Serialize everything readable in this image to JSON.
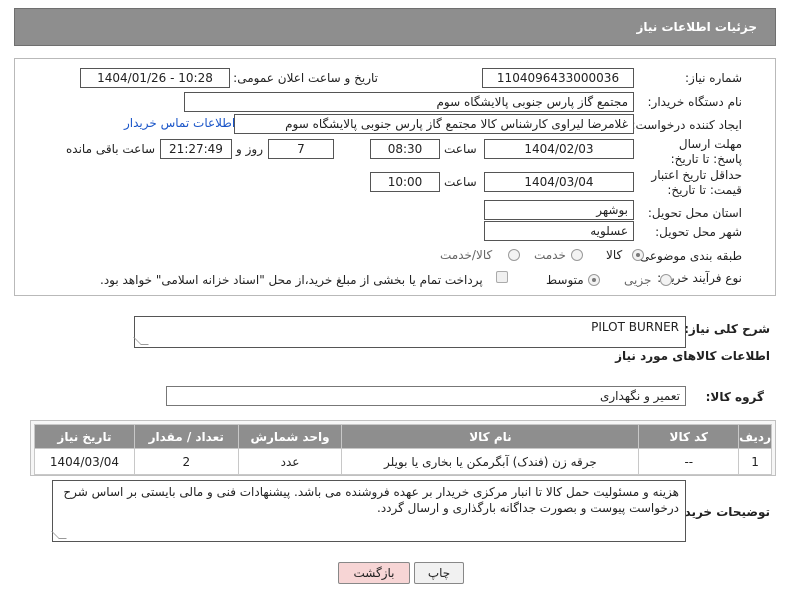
{
  "header": {
    "title": "جزئیات اطلاعات نیاز"
  },
  "fields": {
    "need_number_label": "شماره نیاز:",
    "need_number": "1104096433000036",
    "announce_label": "تاریخ و ساعت اعلان عمومی:",
    "announce_value": "1404/01/26 - 10:28",
    "buyer_org_label": "نام دستگاه خریدار:",
    "buyer_org": "مجتمع گاز پارس جنوبی  پالایشگاه سوم",
    "requester_label": "ایجاد کننده درخواست:",
    "requester": "غلامرضا لیراوی کارشناس کالا مجتمع گاز پارس جنوبی  پالایشگاه سوم",
    "buyer_contact_link": "اطلاعات تماس خریدار",
    "reply_deadline_label": "مهلت ارسال پاسخ: تا تاریخ:",
    "reply_date": "1404/02/03",
    "time_label": "ساعت",
    "reply_time": "08:30",
    "days_value": "7",
    "days_label": "روز و",
    "remaining_time": "21:27:49",
    "remaining_label": "ساعت باقی مانده",
    "price_validity_label": "حداقل تاریخ اعتبار قیمت: تا تاریخ:",
    "validity_date": "1404/03/04",
    "validity_time": "10:00",
    "province_label": "استان محل تحویل:",
    "province": "بوشهر",
    "city_label": "شهر محل تحویل:",
    "city": "عسلویه",
    "category_label": "طبقه بندی موضوعی:",
    "category_options": [
      "کالا",
      "خدمت",
      "کالا/خدمت"
    ],
    "category_selected": "کالا",
    "process_label": "نوع فرآیند خرید :",
    "process_options": [
      "جزیی",
      "متوسط"
    ],
    "process_selected": "متوسط",
    "payment_note": "پرداخت تمام یا بخشی از مبلغ خرید،از محل \"اسناد خزانه اسلامی\" خواهد بود."
  },
  "description": {
    "label": "شرح کلی نیاز:",
    "value": "PILOT BURNER"
  },
  "goods_section": {
    "title": "اطلاعات کالاهای مورد نیاز",
    "group_label": "گروه کالا:",
    "group_value": "تعمیر و نگهداری"
  },
  "table": {
    "headers": [
      "ردیف",
      "کد کالا",
      "نام کالا",
      "واحد شمارش",
      "تعداد / مقدار",
      "تاریخ نیاز"
    ],
    "rows": [
      [
        "1",
        "--",
        "جرقه زن (فندک) آبگرمکن یا بخاری یا بویلر",
        "عدد",
        "2",
        "1404/03/04"
      ]
    ]
  },
  "buyer_notes": {
    "label": "توضیحات خریدار:",
    "value": "هزینه و مسئولیت حمل کالا تا انبار مرکزی خریدار بر عهده فروشنده می باشد. پیشنهادات فنی و مالی بایستی بر اساس شرح درخواست پیوست و بصورت جداگانه بارگذاری و ارسال گردد."
  },
  "buttons": {
    "print": "چاپ",
    "back": "بازگشت"
  }
}
